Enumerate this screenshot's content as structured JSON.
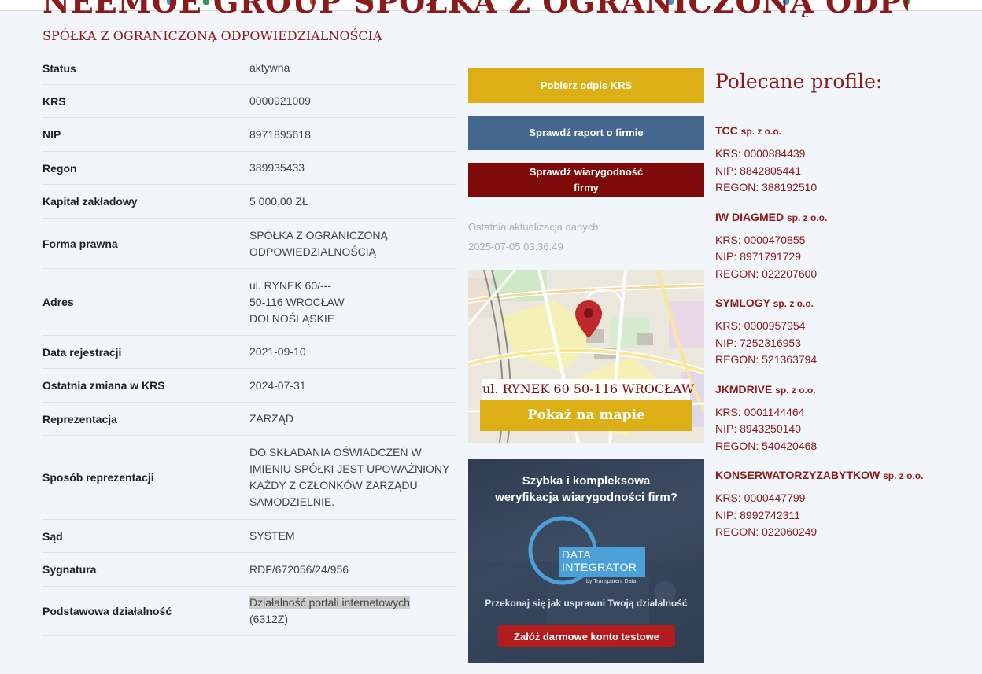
{
  "company": {
    "name": "NEEMOE GROUP SPÓŁKA Z OGRANICZONĄ ODPOWIEDZIALNOŚCIĄ",
    "form_heading": "SPÓŁKA Z OGRANICZONĄ ODPOWIEDZIALNOŚCIĄ"
  },
  "details": [
    {
      "label": "Status",
      "lines": [
        "aktywna"
      ]
    },
    {
      "label": "KRS",
      "lines": [
        "0000921009"
      ]
    },
    {
      "label": "NIP",
      "lines": [
        "8971895618"
      ]
    },
    {
      "label": "Regon",
      "lines": [
        "389935433"
      ]
    },
    {
      "label": "Kapitał zakładowy",
      "lines": [
        "5 000,00 ZŁ"
      ]
    },
    {
      "label": "Forma prawna",
      "lines": [
        "SPÓŁKA Z OGRANICZONĄ",
        "ODPOWIEDZIALNOŚCIĄ"
      ]
    },
    {
      "label": "Adres",
      "lines": [
        "ul. RYNEK 60/---",
        "50-116 WROCŁAW",
        "DOLNOŚLĄSKIE"
      ]
    },
    {
      "label": "Data rejestracji",
      "lines": [
        "2021-09-10"
      ]
    },
    {
      "label": "Ostatnia zmiana w KRS",
      "lines": [
        "2024-07-31"
      ]
    },
    {
      "label": "Reprezentacja",
      "lines": [
        "ZARZĄD"
      ]
    },
    {
      "label": "Sposób reprezentacji",
      "lines": [
        "DO SKŁADANIA OŚWIADCZEŃ W",
        "IMIENIU SPÓŁKI JEST UPOWAŻNIONY",
        "KAŻDY Z CZŁONKÓW ZARZĄDU",
        "SAMODZIELNIE."
      ]
    },
    {
      "label": "Sąd",
      "lines": [
        "SYSTEM"
      ]
    },
    {
      "label": "Sygnatura",
      "lines": [
        "RDF/672056/24/956"
      ]
    },
    {
      "label": "Podstawowa działalność",
      "lines": [
        "Działalność portali internetowych",
        "(6312Z)"
      ]
    }
  ],
  "buttons": {
    "download_krs": "Pobierz odpis KRS",
    "check_report": "Sprawdź raport o firmie",
    "check_credibility": "Sprawdź wiarygodność firmy"
  },
  "update": {
    "label": "Ostatnia aktualizacja danych:",
    "timestamp": "2025-07-05 03:36:49"
  },
  "map": {
    "address": "ul. RYNEK 60 50-116 WROCŁAW",
    "button": "Pokaż na mapie",
    "pin_color": "#c0292b"
  },
  "ad": {
    "title_line1": "Szybka i kompleksowa",
    "title_line2": "weryfikacja wiarygodności firm?",
    "logo_line1": "DATA",
    "logo_line2": "INTEGRATOR",
    "logo_sub": "by Transparent Data",
    "subtitle": "Przekonaj się jak usprawni Twoją działalność",
    "cta": "Załóż darmowe konto testowe"
  },
  "recommended": {
    "title": "Polecane profile:",
    "profiles": [
      {
        "name": "TCC",
        "suffix": "sp. z o.o.",
        "krs": "KRS: 0000884439",
        "nip": "NIP: 8842805441",
        "regon": "REGON: 388192510"
      },
      {
        "name": "IW DIAGMED",
        "suffix": "sp. z o.o.",
        "krs": "KRS: 0000470855",
        "nip": "NIP: 8971791729",
        "regon": "REGON: 022207600"
      },
      {
        "name": "SYMLOGY",
        "suffix": "sp. z o.o.",
        "krs": "KRS: 0000957954",
        "nip": "NIP: 7252316953",
        "regon": "REGON: 521363794"
      },
      {
        "name": "JKMDRIVE",
        "suffix": "sp. z o.o.",
        "krs": "KRS: 0001144464",
        "nip": "NIP: 8943250140",
        "regon": "REGON: 540420468"
      },
      {
        "name": "KONSERWATORZYZABYTKOW",
        "suffix": "sp. z o.o.",
        "krs": "KRS: 0000447799",
        "nip": "NIP: 8992742311",
        "regon": "REGON: 022060249"
      }
    ]
  },
  "colors": {
    "brand": "#8b1a1a",
    "yellow": "#dcaf17",
    "blue": "#446790",
    "red": "#7f0a0a"
  }
}
